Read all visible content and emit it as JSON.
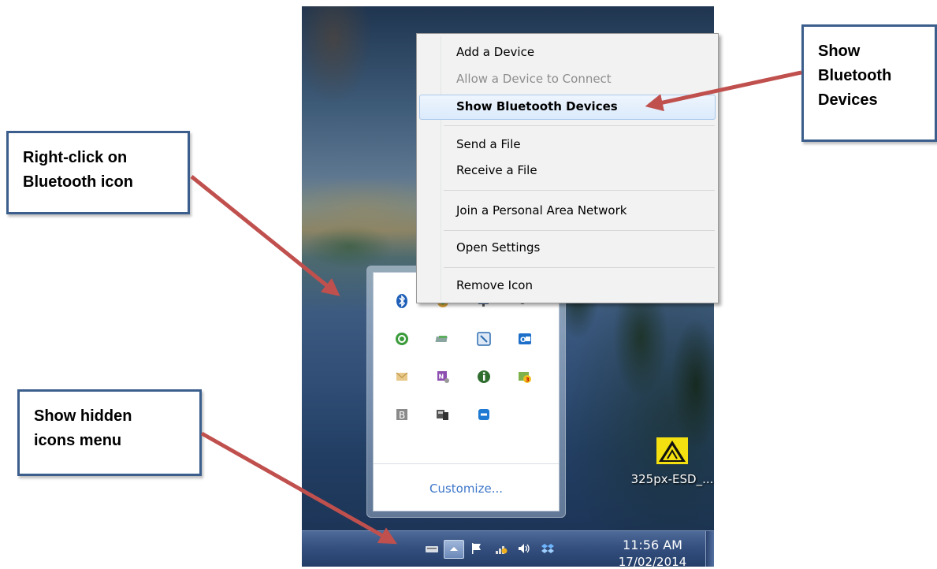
{
  "context_menu": {
    "items": [
      {
        "label": "Add a Device",
        "state": "normal"
      },
      {
        "label": "Allow a Device to Connect",
        "state": "disabled"
      },
      {
        "label": "Show Bluetooth Devices",
        "state": "highlighted"
      },
      {
        "label": "Send a File",
        "state": "normal"
      },
      {
        "label": "Receive a File",
        "state": "normal"
      },
      {
        "label": "Join a Personal Area Network",
        "state": "normal"
      },
      {
        "label": "Open Settings",
        "state": "normal"
      },
      {
        "label": "Remove Icon",
        "state": "normal"
      }
    ]
  },
  "flyout": {
    "customize_label": "Customize...",
    "icons": [
      "bluetooth-icon",
      "security-shield-icon",
      "network-monitor-icon",
      "device-sync-icon",
      "green-refresh-icon",
      "card-reader-icon",
      "tool-app-icon",
      "outlook-icon",
      "mail-envelope-icon",
      "onenote-icon",
      "green-info-icon",
      "badge-folder-icon",
      "b-letter-icon",
      "device-manager-icon",
      "remote-support-icon"
    ],
    "badge_count": "3"
  },
  "taskbar": {
    "time": "11:56 AM",
    "date": "17/02/2014",
    "icons": [
      "keyboard-icon",
      "show-hidden-icons-chevron",
      "action-center-flag-icon",
      "network-signal-icon",
      "volume-icon",
      "dropbox-icon"
    ]
  },
  "desktop_icon": {
    "label": "325px-ESD_..."
  },
  "callouts": {
    "right_click": "Right-click on Bluetooth icon",
    "right_click_lines": [
      "Right-click on",
      "Bluetooth icon"
    ],
    "show_hidden": "Show hidden icons menu",
    "show_hidden_lines": [
      "Show hidden",
      "icons menu"
    ],
    "show_bluetooth": "Show Bluetooth Devices",
    "show_bluetooth_lines": [
      "Show",
      "Bluetooth",
      "Devices"
    ]
  },
  "colors": {
    "arrow": "#c0504d",
    "callout_border": "#3b5e8c",
    "link_blue": "#3d76c9"
  }
}
